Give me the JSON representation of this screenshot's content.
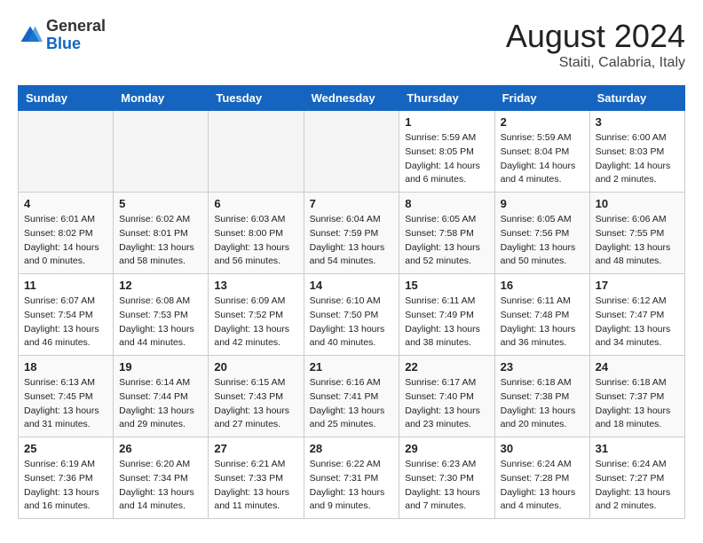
{
  "header": {
    "logo_general": "General",
    "logo_blue": "Blue",
    "month_year": "August 2024",
    "location": "Staiti, Calabria, Italy"
  },
  "days_of_week": [
    "Sunday",
    "Monday",
    "Tuesday",
    "Wednesday",
    "Thursday",
    "Friday",
    "Saturday"
  ],
  "weeks": [
    [
      {
        "day": "",
        "empty": true
      },
      {
        "day": "",
        "empty": true
      },
      {
        "day": "",
        "empty": true
      },
      {
        "day": "",
        "empty": true
      },
      {
        "day": "1",
        "sunrise": "5:59 AM",
        "sunset": "8:05 PM",
        "daylight": "14 hours and 6 minutes"
      },
      {
        "day": "2",
        "sunrise": "5:59 AM",
        "sunset": "8:04 PM",
        "daylight": "14 hours and 4 minutes"
      },
      {
        "day": "3",
        "sunrise": "6:00 AM",
        "sunset": "8:03 PM",
        "daylight": "14 hours and 2 minutes"
      }
    ],
    [
      {
        "day": "4",
        "sunrise": "6:01 AM",
        "sunset": "8:02 PM",
        "daylight": "14 hours and 0 minutes"
      },
      {
        "day": "5",
        "sunrise": "6:02 AM",
        "sunset": "8:01 PM",
        "daylight": "13 hours and 58 minutes"
      },
      {
        "day": "6",
        "sunrise": "6:03 AM",
        "sunset": "8:00 PM",
        "daylight": "13 hours and 56 minutes"
      },
      {
        "day": "7",
        "sunrise": "6:04 AM",
        "sunset": "7:59 PM",
        "daylight": "13 hours and 54 minutes"
      },
      {
        "day": "8",
        "sunrise": "6:05 AM",
        "sunset": "7:58 PM",
        "daylight": "13 hours and 52 minutes"
      },
      {
        "day": "9",
        "sunrise": "6:05 AM",
        "sunset": "7:56 PM",
        "daylight": "13 hours and 50 minutes"
      },
      {
        "day": "10",
        "sunrise": "6:06 AM",
        "sunset": "7:55 PM",
        "daylight": "13 hours and 48 minutes"
      }
    ],
    [
      {
        "day": "11",
        "sunrise": "6:07 AM",
        "sunset": "7:54 PM",
        "daylight": "13 hours and 46 minutes"
      },
      {
        "day": "12",
        "sunrise": "6:08 AM",
        "sunset": "7:53 PM",
        "daylight": "13 hours and 44 minutes"
      },
      {
        "day": "13",
        "sunrise": "6:09 AM",
        "sunset": "7:52 PM",
        "daylight": "13 hours and 42 minutes"
      },
      {
        "day": "14",
        "sunrise": "6:10 AM",
        "sunset": "7:50 PM",
        "daylight": "13 hours and 40 minutes"
      },
      {
        "day": "15",
        "sunrise": "6:11 AM",
        "sunset": "7:49 PM",
        "daylight": "13 hours and 38 minutes"
      },
      {
        "day": "16",
        "sunrise": "6:11 AM",
        "sunset": "7:48 PM",
        "daylight": "13 hours and 36 minutes"
      },
      {
        "day": "17",
        "sunrise": "6:12 AM",
        "sunset": "7:47 PM",
        "daylight": "13 hours and 34 minutes"
      }
    ],
    [
      {
        "day": "18",
        "sunrise": "6:13 AM",
        "sunset": "7:45 PM",
        "daylight": "13 hours and 31 minutes"
      },
      {
        "day": "19",
        "sunrise": "6:14 AM",
        "sunset": "7:44 PM",
        "daylight": "13 hours and 29 minutes"
      },
      {
        "day": "20",
        "sunrise": "6:15 AM",
        "sunset": "7:43 PM",
        "daylight": "13 hours and 27 minutes"
      },
      {
        "day": "21",
        "sunrise": "6:16 AM",
        "sunset": "7:41 PM",
        "daylight": "13 hours and 25 minutes"
      },
      {
        "day": "22",
        "sunrise": "6:17 AM",
        "sunset": "7:40 PM",
        "daylight": "13 hours and 23 minutes"
      },
      {
        "day": "23",
        "sunrise": "6:18 AM",
        "sunset": "7:38 PM",
        "daylight": "13 hours and 20 minutes"
      },
      {
        "day": "24",
        "sunrise": "6:18 AM",
        "sunset": "7:37 PM",
        "daylight": "13 hours and 18 minutes"
      }
    ],
    [
      {
        "day": "25",
        "sunrise": "6:19 AM",
        "sunset": "7:36 PM",
        "daylight": "13 hours and 16 minutes"
      },
      {
        "day": "26",
        "sunrise": "6:20 AM",
        "sunset": "7:34 PM",
        "daylight": "13 hours and 14 minutes"
      },
      {
        "day": "27",
        "sunrise": "6:21 AM",
        "sunset": "7:33 PM",
        "daylight": "13 hours and 11 minutes"
      },
      {
        "day": "28",
        "sunrise": "6:22 AM",
        "sunset": "7:31 PM",
        "daylight": "13 hours and 9 minutes"
      },
      {
        "day": "29",
        "sunrise": "6:23 AM",
        "sunset": "7:30 PM",
        "daylight": "13 hours and 7 minutes"
      },
      {
        "day": "30",
        "sunrise": "6:24 AM",
        "sunset": "7:28 PM",
        "daylight": "13 hours and 4 minutes"
      },
      {
        "day": "31",
        "sunrise": "6:24 AM",
        "sunset": "7:27 PM",
        "daylight": "13 hours and 2 minutes"
      }
    ]
  ]
}
